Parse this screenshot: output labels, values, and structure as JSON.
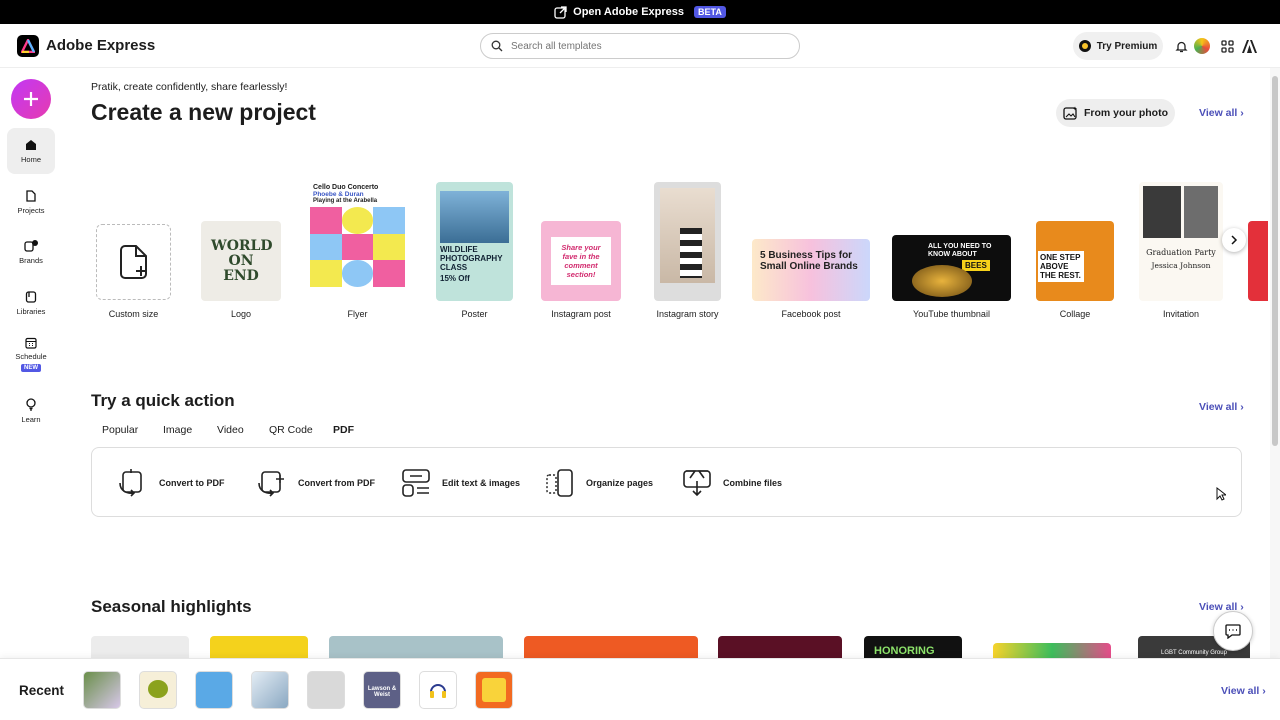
{
  "banner": {
    "text": "Open Adobe Express",
    "badge": "BETA"
  },
  "header": {
    "brand": "Adobe Express",
    "search_placeholder": "Search all templates",
    "premium_label": "Try Premium"
  },
  "sidebar": {
    "items": [
      {
        "label": "Home"
      },
      {
        "label": "Projects"
      },
      {
        "label": "Brands"
      },
      {
        "label": "Libraries"
      },
      {
        "label": "Schedule",
        "badge": "NEW"
      },
      {
        "label": "Learn"
      }
    ]
  },
  "main": {
    "greeting": "Pratik, create confidently, share fearlessly!",
    "title": "Create a new project",
    "from_photo": "From your photo",
    "view_all": "View all",
    "templates": [
      {
        "label": "Custom size"
      },
      {
        "label": "Logo",
        "art": "WORLD ON END"
      },
      {
        "label": "Flyer",
        "art_title": "Cello Duo Concerto",
        "art_sub": "Phoebe & Duran",
        "art_line": "Playing at the Arabella"
      },
      {
        "label": "Poster",
        "art_title": "WILDLIFE PHOTOGRAPHY CLASS",
        "art_offer": "15% Off"
      },
      {
        "label": "Instagram post",
        "art": "Share your fave in the comment section!"
      },
      {
        "label": "Instagram story"
      },
      {
        "label": "Facebook post",
        "art": "5 Business Tips for Small Online Brands"
      },
      {
        "label": "YouTube thumbnail",
        "art": "ALL YOU NEED TO KNOW ABOUT",
        "art_word": "BEES"
      },
      {
        "label": "Collage",
        "art": "ONE STEP ABOVE THE REST."
      },
      {
        "label": "Invitation",
        "art_title": "Graduation Party",
        "art_name": "Jessica Johnson"
      }
    ]
  },
  "quick": {
    "title": "Try a quick action",
    "view_all": "View all",
    "tabs": [
      "Popular",
      "Image",
      "Video",
      "QR Code",
      "PDF"
    ],
    "active_tab": "PDF",
    "actions": [
      "Convert to PDF",
      "Convert from PDF",
      "Edit text & images",
      "Organize pages",
      "Combine files"
    ]
  },
  "seasonal": {
    "title": "Seasonal highlights",
    "view_all": "View all",
    "art_1": "HONORING",
    "art_2": "LGBT Community Group"
  },
  "recent": {
    "title": "Recent",
    "view_all": "View all",
    "thumb_text": "Lawson & Weist"
  },
  "colors": {
    "accent": "#5258e4",
    "link": "#4b4fb8",
    "plus_gradient_start": "#c238f5",
    "plus_gradient_end": "#e63bb0"
  }
}
